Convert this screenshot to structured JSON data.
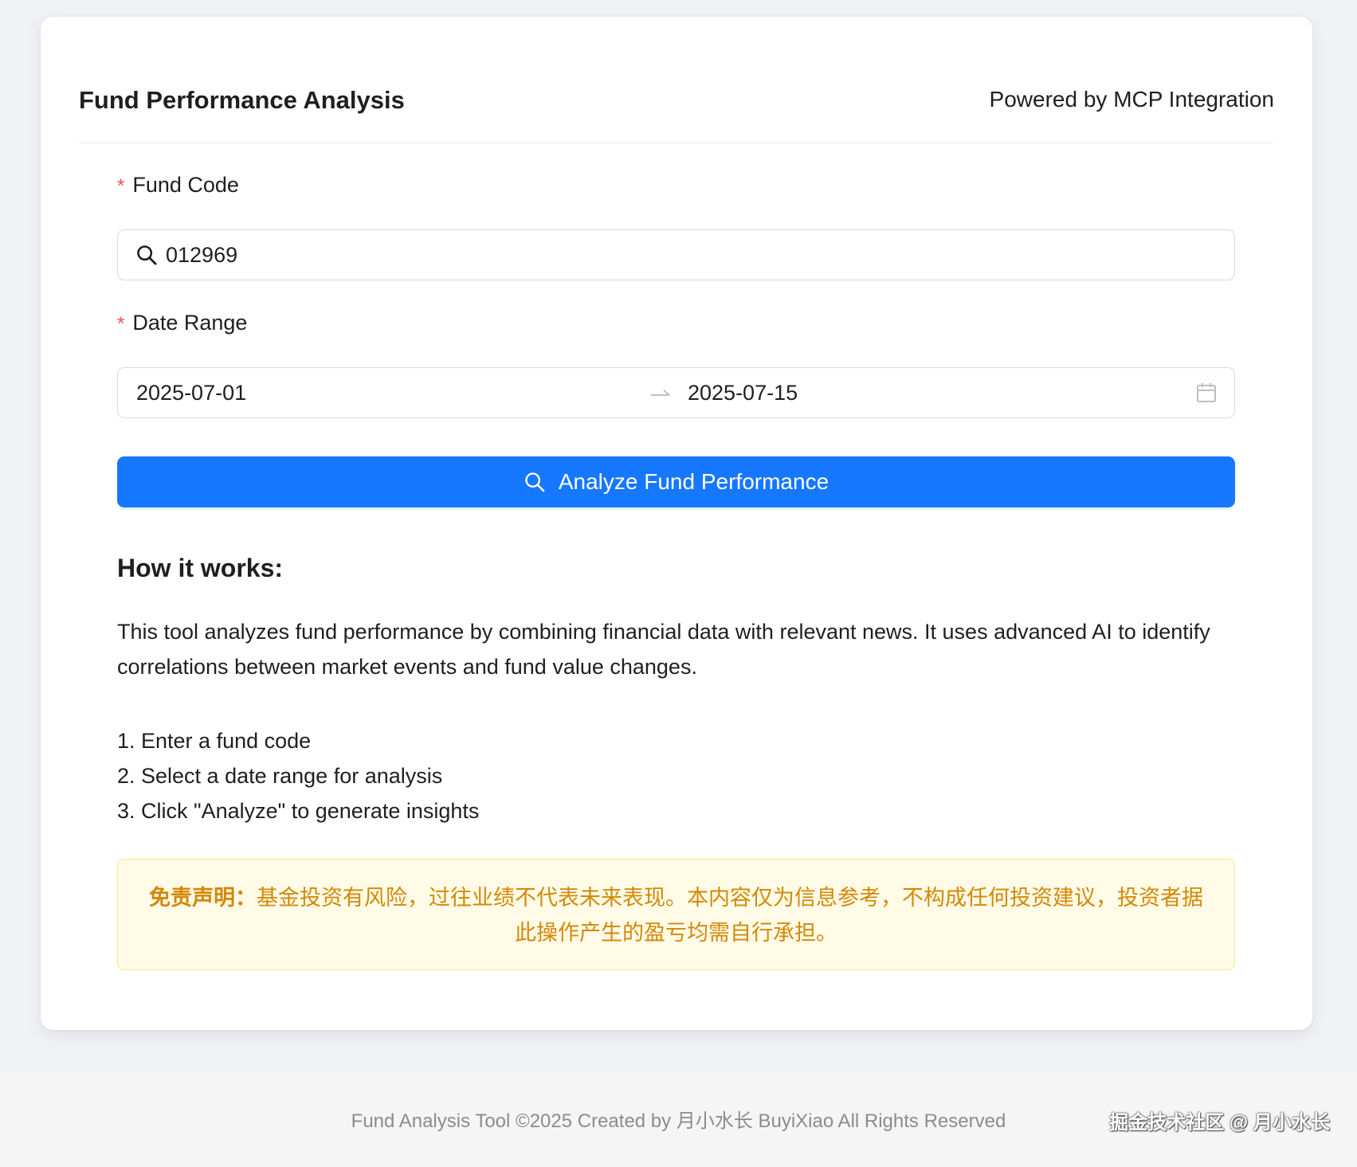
{
  "header": {
    "title": "Fund Performance Analysis",
    "powered_by": "Powered by MCP Integration"
  },
  "form": {
    "fund_code": {
      "required_mark": "*",
      "label": "Fund Code",
      "value": "012969",
      "icon": "search-icon"
    },
    "date_range": {
      "required_mark": "*",
      "label": "Date Range",
      "start": "2025-07-01",
      "end": "2025-07-15",
      "separator_icon": "arrow-right-icon",
      "icon": "calendar-icon"
    },
    "analyze_button": {
      "label": "Analyze Fund Performance",
      "icon": "search-icon"
    }
  },
  "how_it_works": {
    "title": "How it works:",
    "description": "This tool analyzes fund performance by combining financial data with relevant news. It uses advanced AI to identify correlations between market events and fund value changes.",
    "steps": [
      "1. Enter a fund code",
      "2. Select a date range for analysis",
      "3. Click \"Analyze\" to generate insights"
    ]
  },
  "disclaimer": {
    "label": "免责声明：",
    "text": "基金投资有风险，过往业绩不代表未来表现。本内容仅为信息参考，不构成任何投资建议，投资者据此操作产生的盈亏均需自行承担。"
  },
  "footer": {
    "text": "Fund Analysis Tool ©2025 Created by 月小水长 BuyiXiao All Rights Reserved",
    "watermark": "掘金技术社区 @ 月小水长"
  },
  "colors": {
    "primary": "#1677ff",
    "required": "#ff4d4f",
    "warning_text": "#d48806",
    "warning_bg": "#fffbe6",
    "warning_border": "#ffe58f",
    "page_bg": "#f0f2f5"
  }
}
